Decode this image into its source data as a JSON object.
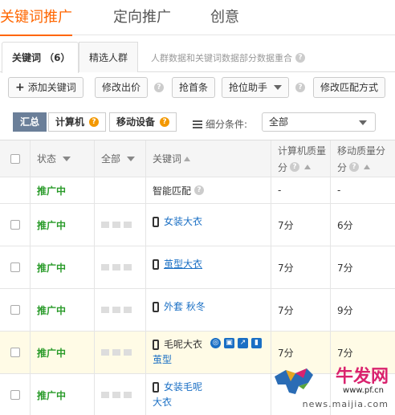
{
  "top_tabs": [
    "关键词推广",
    "定向推广",
    "创意"
  ],
  "sub_tabs": {
    "keywords": "关键词 （6）",
    "crowd": "精选人群",
    "note": "人群数据和关键词数据部分数据重合"
  },
  "toolbar": {
    "add_keyword": "添加关键词",
    "modify_bid": "修改出价",
    "grab_top": "抢首条",
    "rank_helper": "抢位助手",
    "modify_match": "修改匹配方式"
  },
  "filter": {
    "summary": "汇总",
    "computer": "计算机",
    "mobile": "移动设备",
    "subdivide_label": "细分条件:",
    "subdivide_value": "全部"
  },
  "table": {
    "headers": {
      "status": "状态",
      "all": "全部",
      "keyword": "关键词",
      "pc_quality": "计算机质量",
      "pc_quality_unit": "分",
      "mobile_quality": "移动质量分",
      "mobile_quality_unit": "分"
    },
    "rows": [
      {
        "status": "推广中",
        "keyword_line1": "智能匹配",
        "keyword_line2": "",
        "pc": "-",
        "mobile": "-"
      },
      {
        "status": "推广中",
        "keyword_line1": "女装大衣",
        "keyword_line2": "",
        "pc": "7分",
        "mobile": "6分"
      },
      {
        "status": "推广中",
        "keyword_line1": "茧型大衣",
        "keyword_line2": "",
        "pc": "7分",
        "mobile": "7分"
      },
      {
        "status": "推广中",
        "keyword_line1": "外套 秋冬",
        "keyword_line2": "",
        "pc": "7分",
        "mobile": "9分"
      },
      {
        "status": "推广中",
        "keyword_line1": "毛呢大衣",
        "keyword_line2": "茧型",
        "pc": "7分",
        "mobile": "7分"
      },
      {
        "status": "推广中",
        "keyword_line1": "女装毛呢",
        "keyword_line2": "大衣",
        "pc": "",
        "mobile": ""
      }
    ]
  },
  "watermark": {
    "brand": "牛发网",
    "url": "www.pf.cn",
    "url2": "news.maijia.com"
  },
  "colors": {
    "accent": "#ff6600",
    "status_green": "#2a9b2a",
    "link_blue": "#1a6fc4",
    "segment_active": "#6b7f99",
    "highlight_row": "#fffbe6"
  }
}
